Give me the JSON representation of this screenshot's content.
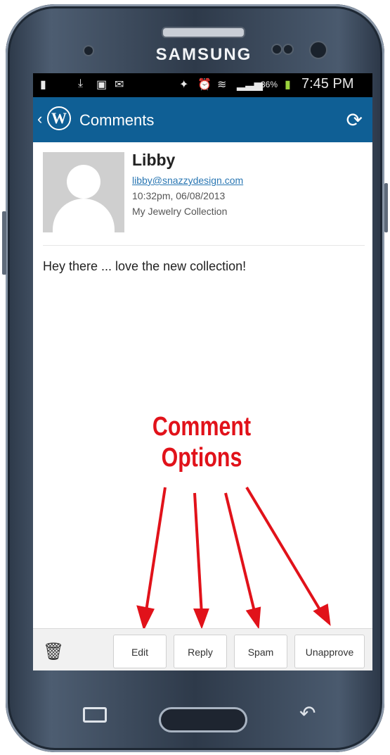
{
  "device": {
    "brand": "SAMSUNG"
  },
  "status_bar": {
    "battery": "36%",
    "time": "7:45 PM",
    "icons": [
      "notification-icon",
      "download-icon",
      "image-icon",
      "mail-icon",
      "bluetooth-icon",
      "alarm-icon",
      "wifi-icon",
      "signal-icon",
      "battery-icon"
    ]
  },
  "action_bar": {
    "title": "Comments",
    "refresh_icon": "refresh-icon",
    "logo_letter": "W"
  },
  "comment": {
    "author": "Libby",
    "email": "libby@snazzydesign.com",
    "datetime": "10:32pm, 06/08/2013",
    "post_title": "My Jewelry Collection",
    "text": "Hey there  ... love the new collection!"
  },
  "annotation": {
    "line1": "Comment",
    "line2": "Options"
  },
  "bottom_bar": {
    "delete_icon": "trash-icon",
    "buttons": [
      {
        "label": "Edit"
      },
      {
        "label": "Reply"
      },
      {
        "label": "Spam"
      },
      {
        "label": "Unapprove"
      }
    ]
  },
  "colors": {
    "action_bar": "#0f5f95",
    "annotation": "#e1121a",
    "link": "#2a77b3"
  }
}
